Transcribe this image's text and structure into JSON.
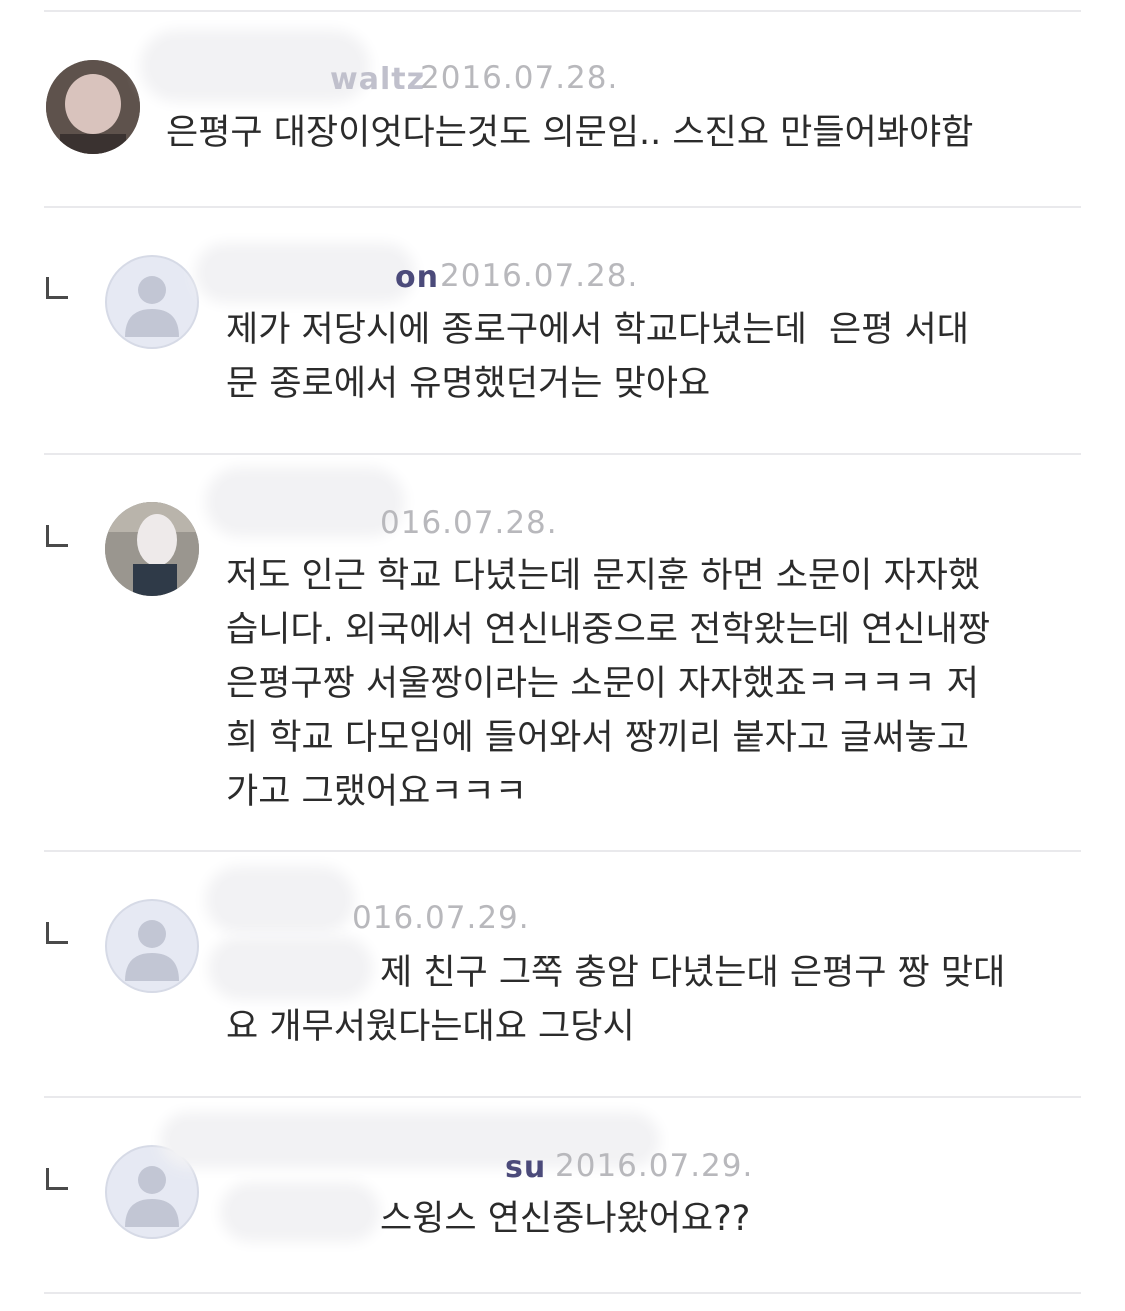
{
  "comments": [
    {
      "name_tail": "waltz",
      "date": "2016.07.28.",
      "text": "은평구 대장이엇다는것도 의문임.. 스진요 만들어봐야함",
      "is_reply": false
    },
    {
      "name_tail": "on",
      "date": "2016.07.28.",
      "text": "제가 저당시에 종로구에서 학교다녔는데  은평 서대\n문 종로에서 유명했던거는 맞아요",
      "is_reply": true
    },
    {
      "name_tail": "",
      "date": "016.07.28.",
      "text": "저도 인근 학교 다녔는데 문지훈 하면 소문이 자자했\n습니다. 외국에서 연신내중으로 전학왔는데 연신내짱\n은평구짱 서울짱이라는 소문이 자자했죠ㅋㅋㅋㅋ 저\n희 학교 다모임에 들어와서 짱끼리 붙자고 글써놓고\n가고 그랬어요ㅋㅋㅋ",
      "is_reply": true
    },
    {
      "name_tail": "",
      "date": "016.07.29.",
      "text": "제 친구 그쪽 충암 다녔는대 은평구 짱 맞대\n요 개무서웠다는대요 그당시",
      "is_reply": true
    },
    {
      "name_tail": "su",
      "date": "2016.07.29.",
      "text": "스윙스 연신중나왔어요??",
      "is_reply": true
    }
  ],
  "icons": {
    "reply": "reply-arrow-icon",
    "default_avatar": "default-user-icon"
  }
}
